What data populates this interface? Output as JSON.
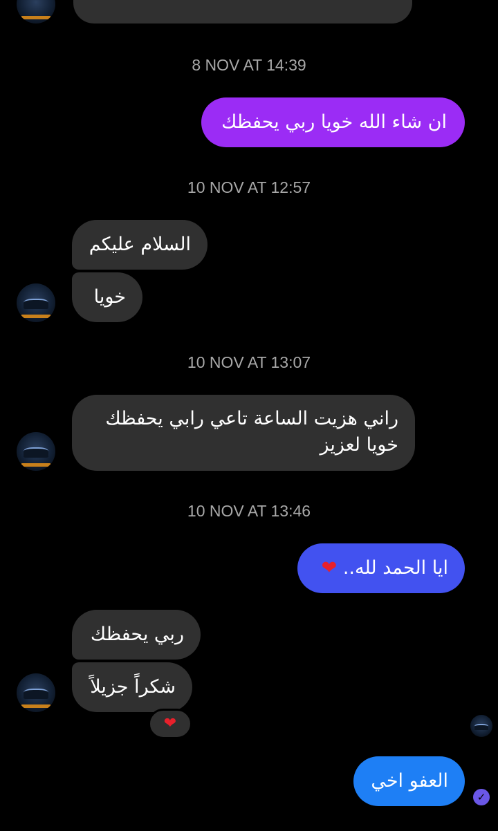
{
  "timestamps": {
    "t1": "8 NOV AT 14:39",
    "t2": "10 NOV AT 12:57",
    "t3": "10 NOV AT 13:07",
    "t4": "10 NOV AT 13:46"
  },
  "messages": {
    "m1": "ان شاء الله خويا ربي يحفظك",
    "m2": "السلام عليكم",
    "m3": "خويا",
    "m4_line1": "راني هزيت الساعة تاعي رابي يحفظك",
    "m4_line2": "خويا لعزيز",
    "m5": "ايا الحمد لله..",
    "m6": "ربي يحفظك",
    "m7": "شكراً جزيلاً",
    "m8": "العفو اخي"
  },
  "icons": {
    "heart": "❤",
    "check": "✓"
  },
  "colors": {
    "background": "#000000",
    "incoming_bubble": "#303030",
    "outgoing_purple": "#9b2cf5",
    "outgoing_blue": "#4252f0",
    "outgoing_lightblue": "#1e7ff5",
    "heart": "#e8202b"
  }
}
